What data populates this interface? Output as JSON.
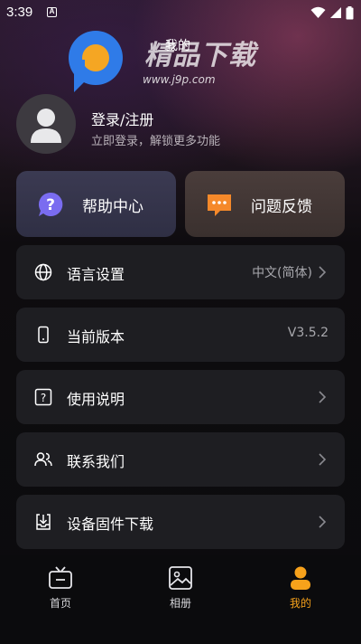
{
  "status_bar": {
    "time": "3:39",
    "notification_icon": "a-icon",
    "icons": [
      "wifi-icon",
      "signal-icon",
      "battery-icon"
    ]
  },
  "watermark": {
    "logo_text": "精品下载",
    "url": "www.j9p.com"
  },
  "page_title": "我的",
  "profile": {
    "login_title": "登录/注册",
    "login_subtitle": "立即登录，解锁更多功能"
  },
  "quick_actions": [
    {
      "label": "帮助中心",
      "icon": "question-bubble-icon",
      "color": "#7a6cf0"
    },
    {
      "label": "问题反馈",
      "icon": "chat-bubble-icon",
      "color": "#f5892a"
    }
  ],
  "settings": [
    {
      "label": "语言设置",
      "value": "中文(简体)",
      "icon": "globe-icon"
    },
    {
      "label": "当前版本",
      "value": "V3.5.2",
      "icon": "phone-icon"
    },
    {
      "label": "使用说明",
      "value": "",
      "icon": "question-box-icon"
    },
    {
      "label": "联系我们",
      "value": "",
      "icon": "users-icon"
    },
    {
      "label": "设备固件下载",
      "value": "",
      "icon": "download-tray-icon"
    }
  ],
  "bottom_nav": [
    {
      "label": "首页",
      "icon": "tv-icon",
      "active": false
    },
    {
      "label": "相册",
      "icon": "image-icon",
      "active": false
    },
    {
      "label": "我的",
      "icon": "person-icon",
      "active": true
    }
  ],
  "colors": {
    "accent_orange": "#f7a21b",
    "row_background": "#1e1e22",
    "help_card": "#34344a",
    "feedback_card": "#433735"
  }
}
